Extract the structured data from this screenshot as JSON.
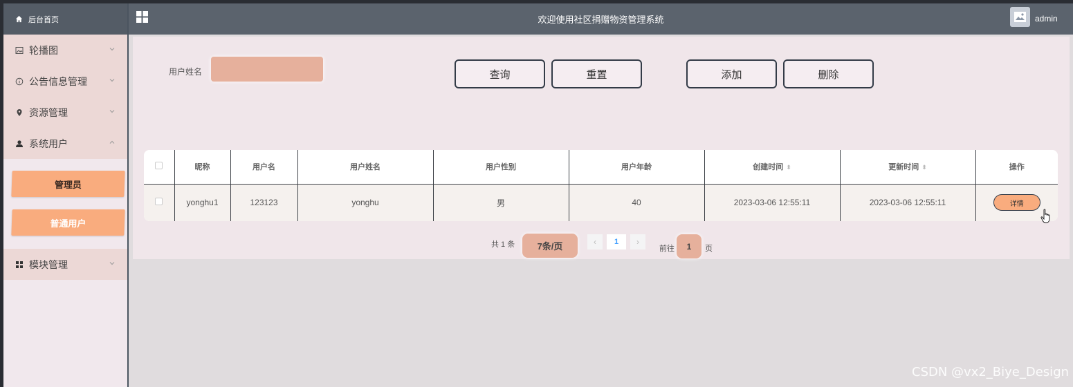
{
  "sidebar": {
    "home_label": "后台首页",
    "menu": [
      {
        "label": "轮播图",
        "icon": "picture-icon"
      },
      {
        "label": "公告信息管理",
        "icon": "info-icon"
      },
      {
        "label": "资源管理",
        "icon": "location-pin-icon"
      },
      {
        "label": "系统用户",
        "icon": "user-icon",
        "expanded": true
      },
      {
        "label": "模块管理",
        "icon": "grid-icon"
      }
    ],
    "submenu": [
      {
        "label": "管理员",
        "active": true
      },
      {
        "label": "普通用户",
        "active": false
      }
    ]
  },
  "header": {
    "title": "欢迎使用社区捐赠物资管理系统",
    "username": "admin"
  },
  "search": {
    "label": "用户姓名",
    "value": "",
    "buttons": {
      "query": "查询",
      "reset": "重置",
      "add": "添加",
      "delete": "删除"
    }
  },
  "table": {
    "columns": [
      "昵称",
      "用户名",
      "用户姓名",
      "用户性别",
      "用户年龄",
      "创建时间",
      "更新时间",
      "操作"
    ],
    "rows": [
      {
        "nickname": "yonghu1",
        "username": "123123",
        "name": "yonghu",
        "gender": "男",
        "age": "40",
        "created": "2023-03-06 12:55:11",
        "updated": "2023-03-06 12:55:11",
        "action": "详情"
      }
    ]
  },
  "pagination": {
    "total": "共 1 条",
    "page_size": "7条/页",
    "current_page": "1",
    "goto_label": "前往",
    "goto_value": "1",
    "page_unit": "页"
  },
  "colors": {
    "accent": "#f9ac7e",
    "header_bg": "#5b636d",
    "content_bg": "#f0e6ea"
  },
  "watermark": "CSDN @vx2_Biye_Design"
}
